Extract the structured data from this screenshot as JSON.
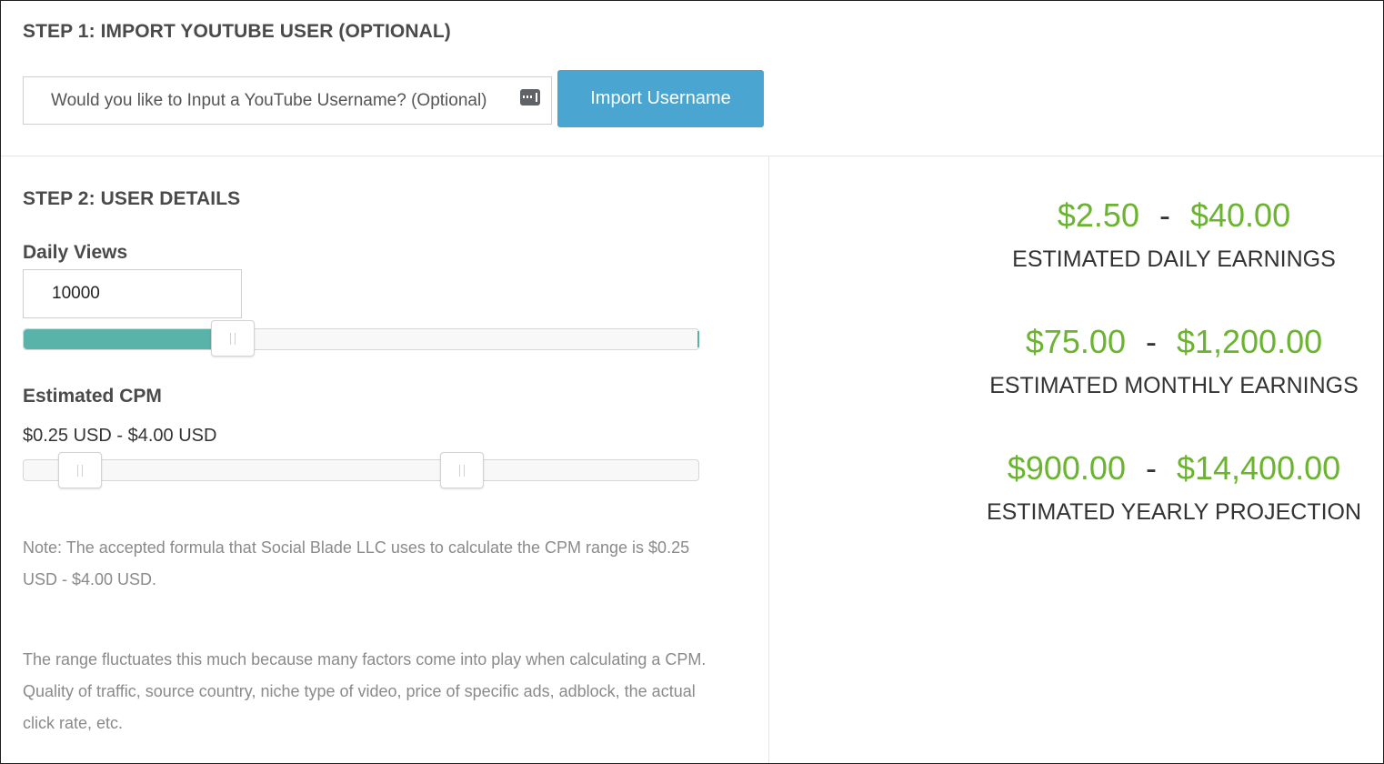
{
  "step1": {
    "heading": "STEP 1: IMPORT YOUTUBE USER (OPTIONAL)",
    "username_placeholder": "Would you like to Input a YouTube Username? (Optional)",
    "username_value": "",
    "import_button_label": "Import Username",
    "accent_color": "#4aa6d0"
  },
  "step2": {
    "heading": "STEP 2: USER DETAILS",
    "daily_views": {
      "label": "Daily Views",
      "value": "10000",
      "slider_fraction": 0.31,
      "fill_color": "#5ab3a8"
    },
    "cpm": {
      "label": "Estimated CPM",
      "range_text": "$0.25 USD - $4.00 USD",
      "low_value": 0.25,
      "high_value": 4.0
    },
    "note_1": "Note: The accepted formula that Social Blade LLC uses to calculate the CPM range is $0.25 USD - $4.00 USD.",
    "note_2": "The range fluctuates this much because many factors come into play when calculating a CPM. Quality of traffic, source country, niche type of video, price of specific ads, adblock, the actual click rate, etc."
  },
  "earnings": {
    "value_color": "#6ab42f",
    "separator": "-",
    "daily": {
      "low": "$2.50",
      "high": "$40.00",
      "label": "ESTIMATED DAILY EARNINGS"
    },
    "monthly": {
      "low": "$75.00",
      "high": "$1,200.00",
      "label": "ESTIMATED MONTHLY EARNINGS"
    },
    "yearly": {
      "low": "$900.00",
      "high": "$14,400.00",
      "label": "ESTIMATED YEARLY PROJECTION"
    }
  }
}
